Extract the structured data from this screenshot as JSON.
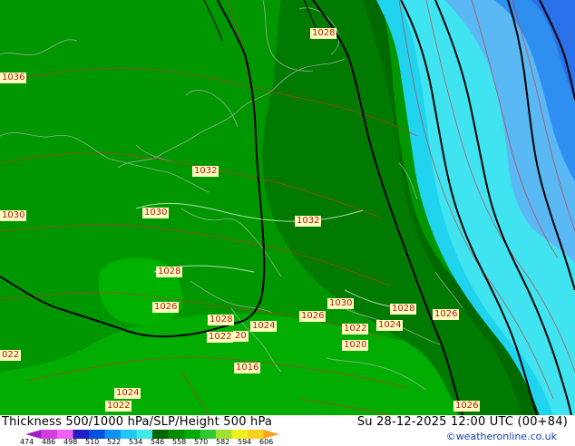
{
  "title": "Thickness 500/1000 hPa/SLP/Height 500 hPa",
  "datetime": "Su 28-12-2025 12:00 UTC (00+84)",
  "credit": "©weatheronline.co.uk",
  "legend": {
    "ticks": [
      "474",
      "486",
      "498",
      "510",
      "522",
      "534",
      "546",
      "558",
      "570",
      "582",
      "594",
      "606"
    ],
    "colors": [
      "#a020c0",
      "#d040e0",
      "#f060f0",
      "#2020c0",
      "#0050e0",
      "#1090f0",
      "#20c8f8",
      "#40e8e8",
      "#006400",
      "#008c00",
      "#00aa00",
      "#30c830",
      "#a0e030",
      "#f0f020",
      "#f8d020",
      "#f8a020"
    ]
  },
  "isobar_labels": [
    {
      "text": "1028"
    },
    {
      "text": "1036"
    },
    {
      "text": "1032"
    },
    {
      "text": "1030"
    },
    {
      "text": "1030"
    },
    {
      "text": "1032"
    },
    {
      "text": "1028"
    },
    {
      "text": "1026"
    },
    {
      "text": "1028"
    },
    {
      "text": "1024"
    },
    {
      "text": "1030"
    },
    {
      "text": "1026"
    },
    {
      "text": "1028"
    },
    {
      "text": "1026"
    },
    {
      "text": "1022"
    },
    {
      "text": "1024"
    },
    {
      "text": "1022"
    },
    {
      "text": "20"
    },
    {
      "text": "1020"
    },
    {
      "text": "1016"
    },
    {
      "text": "1024"
    },
    {
      "text": "1022"
    },
    {
      "text": "022"
    },
    {
      "text": "1026"
    }
  ]
}
